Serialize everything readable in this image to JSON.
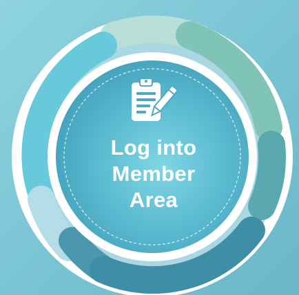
{
  "member_login": {
    "label_lines": [
      "Log into",
      "Member",
      "Area"
    ],
    "icon": "clipboard-pen-icon",
    "colors": {
      "background": "#7cc6d6",
      "ring_white": "#ffffff",
      "segment_mint": "#b7dfd8",
      "segment_green": "#7fc4b6",
      "segment_sky": "#67c9da",
      "segment_teal": "#5aa9b1",
      "segment_pale": "#b4dde8",
      "segment_ocean": "#4b97ad",
      "segment_deep": "#3f8ea8",
      "center_light": "#7fd3e2",
      "center_dark": "#3e9bb6",
      "label": "#ffffff"
    }
  }
}
